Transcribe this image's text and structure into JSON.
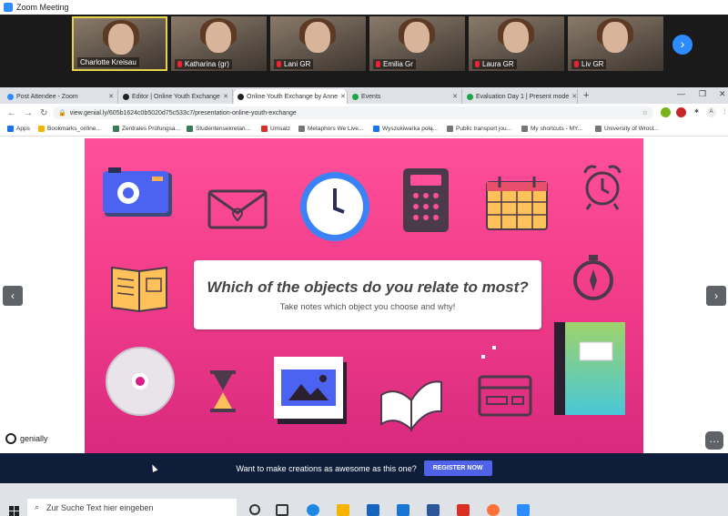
{
  "zoom": {
    "window_title": "Zoom Meeting",
    "participants": [
      {
        "name": "Charlotte Kreisau",
        "muted": false,
        "active": true
      },
      {
        "name": "Katharina (gr)",
        "muted": true,
        "active": false
      },
      {
        "name": "Lani GR",
        "muted": true,
        "active": false
      },
      {
        "name": "Emilia Gr",
        "muted": true,
        "active": false
      },
      {
        "name": "Laura GR",
        "muted": true,
        "active": false
      },
      {
        "name": "Liv GR",
        "muted": true,
        "active": false
      }
    ],
    "next_icon": "chevron-right-icon"
  },
  "browser": {
    "tabs": [
      {
        "label": "Post Attendee - Zoom",
        "color": "#2d8cff"
      },
      {
        "label": "Editor | Online Youth Exchange",
        "color": "#222222"
      },
      {
        "label": "Online Youth Exchange by Anne",
        "color": "#222222"
      },
      {
        "label": "Events",
        "color": "#1ea446"
      },
      {
        "label": "Evaluation Day 1 | Present mode",
        "color": "#1ea446"
      }
    ],
    "url": "view.genial.ly/605b1624c0b5020d75c533c7/presentation-online-youth-exchange",
    "bookmarks": [
      "Apps",
      "Bookmarks_online...",
      "Zentrales Prüfungsa...",
      "Studentensekretari...",
      "Umsatz",
      "Metaphors We Live...",
      "Wyszukiwarka połą...",
      "Public transport jou...",
      "My shortcuts - MY...",
      "University of Wrocł..."
    ]
  },
  "slide": {
    "question": "Which of the objects do you relate to most?",
    "subtitle": "Take notes which object you choose and why!",
    "background_color": "#ff4f9b",
    "objects": [
      "camera-icon",
      "envelope-icon",
      "clock-icon",
      "calculator-icon",
      "calendar-icon",
      "alarm-clock-icon",
      "book-icon",
      "compass-icon",
      "cd-icon",
      "hourglass-icon",
      "picture-icon",
      "open-book-icon",
      "credit-card-icon",
      "notebook-icon"
    ]
  },
  "genially": {
    "logo_text": "genially",
    "promo_text": "Want to make creations as awesome as this one?",
    "register_label": "REGISTER NOW"
  },
  "taskbar": {
    "search_placeholder": "Zur Suche Text hier eingeben"
  }
}
